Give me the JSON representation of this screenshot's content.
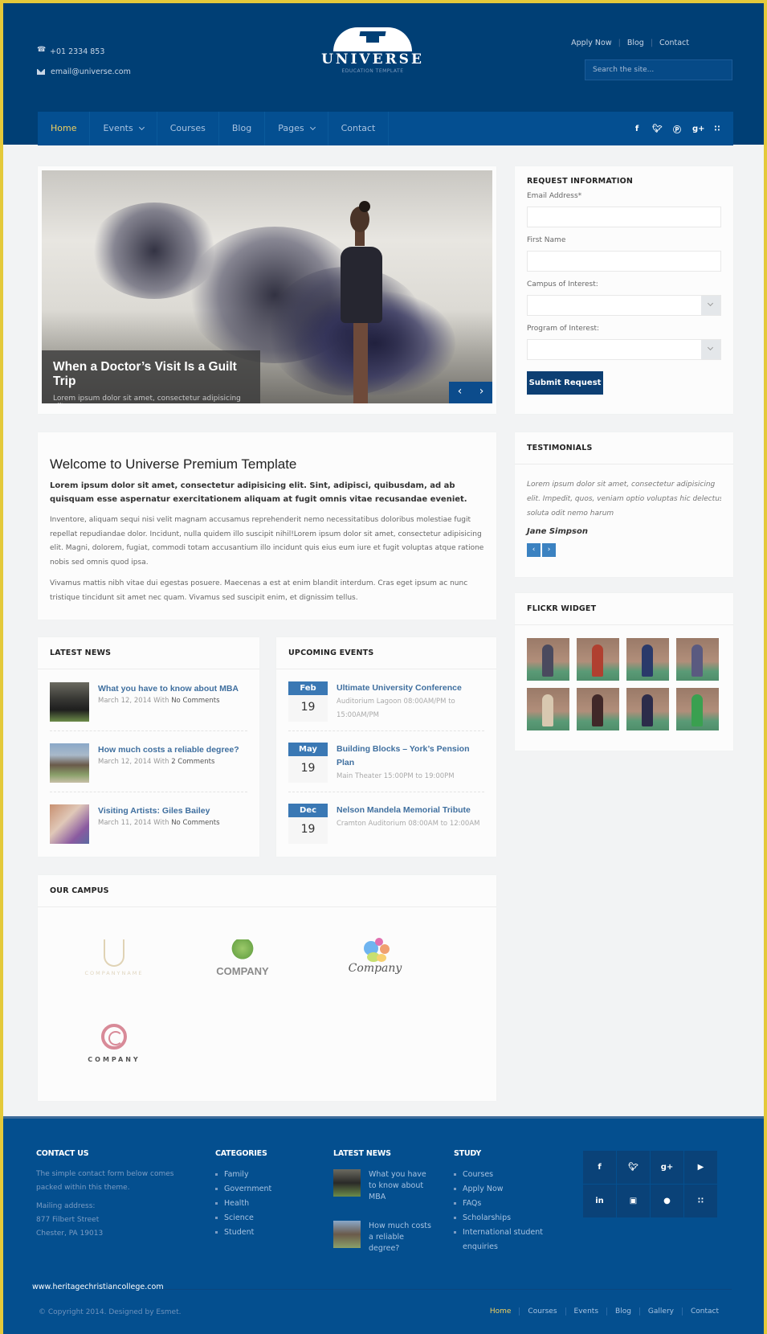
{
  "header": {
    "phone": "+01 2334 853",
    "email": "email@universe.com",
    "logo_title": "UNIVERSE",
    "logo_subtitle": "EDUCATION TEMPLATE",
    "top_links": [
      "Apply Now",
      "Blog",
      "Contact"
    ],
    "search_placeholder": "Search the site..."
  },
  "nav": {
    "items": [
      {
        "label": "Home",
        "active": true,
        "dropdown": false
      },
      {
        "label": "Events",
        "active": false,
        "dropdown": true
      },
      {
        "label": "Courses",
        "active": false,
        "dropdown": false
      },
      {
        "label": "Blog",
        "active": false,
        "dropdown": false
      },
      {
        "label": "Pages",
        "active": false,
        "dropdown": true
      },
      {
        "label": "Contact",
        "active": false,
        "dropdown": false
      }
    ],
    "social": [
      "f",
      "t",
      "p",
      "g+",
      "rss"
    ]
  },
  "slider": {
    "title": "When a Doctor’s Visit Is a Guilt Trip",
    "text": "Lorem ipsum dolor sit amet, consectetur adipisicing elit...",
    "prev": "‹",
    "next": "›"
  },
  "request": {
    "title": "REQUEST INFORMATION",
    "email_label": "Email Address*",
    "email_value": "",
    "first_name_label": "First Name",
    "first_name_value": "",
    "campus_label": "Campus of Interest:",
    "campus_value": "",
    "program_label": "Program of Interest:",
    "program_value": "",
    "submit_label": "Submit Request"
  },
  "welcome": {
    "title": "Welcome to Universe Premium Template",
    "lead": "Lorem ipsum dolor sit amet, consectetur adipisicing elit. Sint, adipisci, quibusdam, ad ab quisquam esse aspernatur exercitationem aliquam at fugit omnis vitae recusandae eveniet.",
    "paragraph1": "Inventore, aliquam sequi nisi velit magnam accusamus reprehenderit nemo necessitatibus doloribus molestiae fugit repellat repudiandae dolor. Incidunt, nulla quidem illo suscipit nihil!Lorem ipsum dolor sit amet, consectetur adipisicing elit. Magni, dolorem, fugiat, commodi totam accusantium illo incidunt quis eius eum iure et fugit voluptas atque ratione nobis sed omnis quod ipsa.",
    "paragraph2": "Vivamus mattis nibh vitae dui egestas posuere. Maecenas a est at enim blandit interdum. Cras eget ipsum ac nunc tristique tincidunt sit amet nec quam. Vivamus sed suscipit enim, et dignissim tellus."
  },
  "testimonials": {
    "title": "TESTIMONIALS",
    "quote_lines": [
      "Lorem ipsum dolor sit amet, consectetur adipisicing",
      "elit. Impedit, quos, veniam optio voluptas hic delectus",
      "soluta odit nemo harum"
    ],
    "author": "Jane Simpson",
    "prev": "‹",
    "next": "›"
  },
  "flickr": {
    "title": "FLICKR WIDGET",
    "photo_count": 8
  },
  "latest_news": {
    "title": "LATEST NEWS",
    "items": [
      {
        "title": "What you have to know about MBA",
        "date": "March 12, 2014",
        "with": "With",
        "comments": "No Comments"
      },
      {
        "title": "How much costs a reliable degree?",
        "date": "March 12, 2014",
        "with": "With",
        "comments": "2 Comments"
      },
      {
        "title": "Visiting Artists: Giles Bailey",
        "date": "March 11, 2014",
        "with": "With",
        "comments": "No Comments"
      }
    ]
  },
  "events": {
    "title": "UPCOMING EVENTS",
    "items": [
      {
        "month": "Feb",
        "day": "19",
        "title": "Ultimate University Conference",
        "details": "Auditorium Lagoon 08:00AM/PM to 15:00AM/PM"
      },
      {
        "month": "May",
        "day": "19",
        "title": "Building Blocks – York’s Pension Plan",
        "details": "Main Theater 15:00PM to 19:00PM"
      },
      {
        "month": "Dec",
        "day": "19",
        "title": "Nelson Mandela Memorial Tribute",
        "details": "Cramton Auditorium 08:00AM to 12:00AM"
      }
    ]
  },
  "campus": {
    "title": "OUR CAMPUS",
    "logos": [
      "COMPANYNAME",
      "COMPANY",
      "Company",
      "COMPANY"
    ]
  },
  "footer": {
    "contact_title": "CONTACT US",
    "contact_text": "The simple contact form below comes packed within this theme.",
    "mailing_label": "Mailing address:",
    "address_line1": "877 Filbert Street",
    "address_line2": "Chester, PA 19013",
    "categories_title": "CATEGORIES",
    "categories": [
      "Family",
      "Government",
      "Health",
      "Science",
      "Student"
    ],
    "news_title": "LATEST NEWS",
    "news": [
      "What you have to know about MBA",
      "How much costs a reliable degree?"
    ],
    "study_title": "STUDY",
    "study": [
      "Courses",
      "Apply Now",
      "FAQs",
      "Scholarships",
      "International student enquiries"
    ],
    "social": [
      "f",
      "t",
      "g+",
      "yt",
      "in",
      "ig",
      "apple",
      "rss"
    ],
    "watermark": "www.heritagechristiancollege.com",
    "copyright": "© Copyright 2014. Designed by Esmet.",
    "bottom_nav": [
      "Home",
      "Courses",
      "Events",
      "Blog",
      "Gallery",
      "Contact"
    ],
    "bottom_nav_active": "Home"
  },
  "colors": {
    "header_bg": "#003f75",
    "nav_bg": "#044f91",
    "nav_active": "#f0d060",
    "link_blue": "#3f6f9f",
    "event_month_bg": "#3a78b4",
    "submit_bg": "#0d3f73",
    "footer_bg": "#044f8f",
    "frame_border": "#e4c93a"
  }
}
